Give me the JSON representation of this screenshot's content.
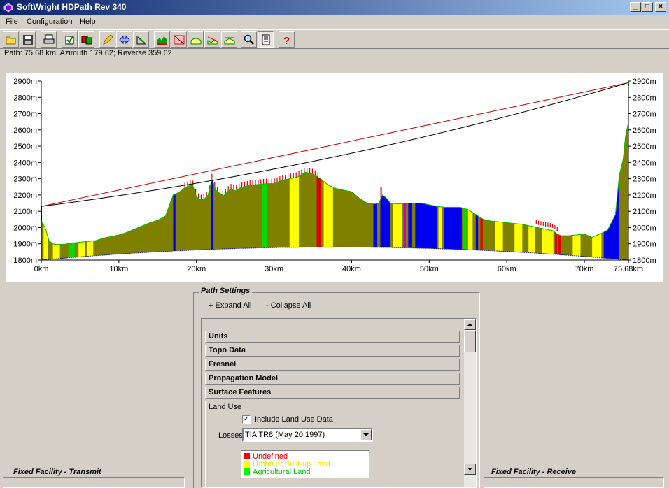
{
  "window": {
    "title": "SoftWright HDPath Rev 340",
    "buttons": [
      "_",
      "□",
      "×"
    ]
  },
  "menu": [
    "File",
    "Configuration",
    "Help"
  ],
  "toolbar": {
    "icons": [
      "open-icon",
      "save-icon",
      "print-icon",
      "edit-site-icon",
      "swap-sites-icon",
      "pencil-icon",
      "flip-path-icon",
      "grade-icon",
      "terrain-icon",
      "clearance-icon",
      "fresnel-icon",
      "reflection-icon",
      "diffraction-icon",
      "zoom-icon",
      "report-icon",
      "help-icon"
    ]
  },
  "path_info": "Path: 75.68 km; Azimuth 179.62; Reverse 359.62",
  "chart_data": {
    "type": "area",
    "x_unit": "km",
    "y_unit": "m",
    "xlim": [
      0,
      75.68
    ],
    "ylim": [
      1800,
      2900
    ],
    "x_ticks": [
      "0km",
      "10km",
      "20km",
      "30km",
      "40km",
      "50km",
      "60km",
      "70km",
      "75.68km"
    ],
    "x_tick_values": [
      0,
      10,
      20,
      30,
      40,
      50,
      60,
      70,
      75.68
    ],
    "y_ticks": [
      "1800m",
      "1900m",
      "2000m",
      "2100m",
      "2200m",
      "2300m",
      "2400m",
      "2500m",
      "2600m",
      "2700m",
      "2800m",
      "2900m"
    ],
    "y_tick_values": [
      1800,
      1900,
      2000,
      2100,
      2200,
      2300,
      2400,
      2500,
      2600,
      2700,
      2800,
      2900
    ],
    "terrain": {
      "x": [
        0,
        0.5,
        1,
        1.5,
        2,
        3,
        4,
        5,
        6,
        7,
        8,
        9,
        10,
        11,
        12,
        13,
        14,
        15,
        16,
        17,
        17.5,
        18,
        18.5,
        19,
        19.5,
        20,
        20.5,
        21,
        21.5,
        22,
        22.5,
        23,
        23.5,
        24,
        24.5,
        25,
        25.5,
        26,
        26.5,
        27,
        28,
        29,
        30,
        31,
        32,
        33,
        34,
        35,
        36,
        37,
        38,
        39,
        40,
        41,
        42,
        43,
        43.5,
        44,
        44.5,
        45,
        46,
        47,
        48,
        49,
        50,
        51,
        52,
        53,
        54,
        55,
        56,
        57,
        58,
        59,
        60,
        61,
        62,
        63,
        64,
        65,
        66,
        66.5,
        67,
        68,
        69,
        70,
        71,
        72,
        73,
        74,
        74.5,
        75,
        75.3,
        75.68
      ],
      "y": [
        2040,
        2000,
        1920,
        1900,
        1895,
        1898,
        1905,
        1910,
        1915,
        1920,
        1935,
        1945,
        1955,
        1970,
        1990,
        2010,
        2030,
        2045,
        2070,
        2200,
        2210,
        2225,
        2245,
        2255,
        2265,
        2190,
        2170,
        2175,
        2200,
        2300,
        2230,
        2210,
        2195,
        2220,
        2240,
        2225,
        2240,
        2250,
        2255,
        2260,
        2265,
        2270,
        2270,
        2290,
        2300,
        2310,
        2340,
        2330,
        2300,
        2260,
        2240,
        2230,
        2220,
        2180,
        2150,
        2145,
        2150,
        2200,
        2180,
        2150,
        2145,
        2150,
        2150,
        2150,
        2140,
        2130,
        2125,
        2125,
        2125,
        2110,
        2080,
        2050,
        2040,
        2035,
        2030,
        2025,
        2020,
        2010,
        2000,
        1990,
        1980,
        1960,
        1950,
        1950,
        1955,
        1960,
        1940,
        1960,
        1985,
        2080,
        2320,
        2420,
        2560,
        2650,
        2870
      ],
      "earth_curvature_bottom_y": [
        1800,
        1820,
        1835,
        1850,
        1862,
        1872,
        1878,
        1880,
        1878,
        1872,
        1862,
        1850,
        1835,
        1820,
        1800
      ]
    },
    "land_use_bands": [
      {
        "from": 0.3,
        "to": 0.9,
        "color": "yellow"
      },
      {
        "from": 1.5,
        "to": 2.4,
        "color": "yellow"
      },
      {
        "from": 3.5,
        "to": 4.3,
        "color": "green"
      },
      {
        "from": 4.8,
        "to": 5.6,
        "color": "yellow"
      },
      {
        "from": 5.9,
        "to": 6.7,
        "color": "yellow"
      },
      {
        "from": 17,
        "to": 17.3,
        "color": "blue"
      },
      {
        "from": 21.9,
        "to": 22.2,
        "color": "blue"
      },
      {
        "from": 28.5,
        "to": 29.1,
        "color": "green"
      },
      {
        "from": 32,
        "to": 33.2,
        "color": "yellow"
      },
      {
        "from": 35.5,
        "to": 36,
        "color": "red"
      },
      {
        "from": 36.4,
        "to": 37.6,
        "color": "yellow"
      },
      {
        "from": 42.8,
        "to": 43.3,
        "color": "blue"
      },
      {
        "from": 43.7,
        "to": 45,
        "color": "blue"
      },
      {
        "from": 45.3,
        "to": 46.5,
        "color": "yellow"
      },
      {
        "from": 46.7,
        "to": 47,
        "color": "magenta"
      },
      {
        "from": 47.3,
        "to": 47.8,
        "color": "blue"
      },
      {
        "from": 48.2,
        "to": 51,
        "color": "blue"
      },
      {
        "from": 51.2,
        "to": 51.6,
        "color": "yellow"
      },
      {
        "from": 51.9,
        "to": 54.2,
        "color": "blue"
      },
      {
        "from": 54.3,
        "to": 54.8,
        "color": "green"
      },
      {
        "from": 55,
        "to": 55.6,
        "color": "yellow"
      },
      {
        "from": 56,
        "to": 56.3,
        "color": "blue"
      },
      {
        "from": 56.6,
        "to": 56.9,
        "color": "red"
      },
      {
        "from": 58.5,
        "to": 59.5,
        "color": "yellow"
      },
      {
        "from": 61,
        "to": 62,
        "color": "yellow"
      },
      {
        "from": 62.8,
        "to": 63.6,
        "color": "yellow"
      },
      {
        "from": 64.5,
        "to": 66,
        "color": "yellow"
      },
      {
        "from": 66.2,
        "to": 66.5,
        "color": "red"
      },
      {
        "from": 66.6,
        "to": 67,
        "color": "red"
      },
      {
        "from": 68.5,
        "to": 69.5,
        "color": "yellow"
      },
      {
        "from": 71,
        "to": 72.2,
        "color": "yellow"
      },
      {
        "from": 72.5,
        "to": 74.5,
        "color": "blue"
      }
    ],
    "obstruction_spikes": [
      {
        "x": 43.8,
        "y": 2250
      }
    ],
    "line_of_sight": {
      "from": [
        0,
        2130
      ],
      "to": [
        75.68,
        2890
      ],
      "color": "#cc0000"
    },
    "radio_path": {
      "from": [
        0,
        2130
      ],
      "to": [
        75.68,
        2890
      ],
      "sag": 150,
      "color": "#000000"
    },
    "colors": {
      "terrain": "#808000",
      "yellow": "#ffff00",
      "green": "#00dd00",
      "blue": "#0000ee",
      "red": "#dd0000",
      "magenta": "#cc00cc"
    },
    "grid": false
  },
  "bottom": {
    "left_group": "Fixed Facility - Transmit",
    "right_group": "Fixed Facility - Receive",
    "settings": {
      "title": "Path Settings",
      "expand": "+ Expand All",
      "collapse": "- Collapse All",
      "sections": [
        "Units",
        "Topo Data",
        "Fresnel",
        "Propagation Model",
        "Surface Features"
      ],
      "land_use_label": "Land Use",
      "include_checkbox": "Include Land Use Data",
      "include_checked": true,
      "losses_label": "Losses",
      "losses_value": "TIA TR8 (May 20 1997)",
      "legend": [
        {
          "label": "Undefined",
          "color": "#ff0000"
        },
        {
          "label": "Urban or Built-up Land",
          "color": "#ffff00"
        },
        {
          "label": "Agricultural Land",
          "color": "#00ff00"
        }
      ]
    }
  }
}
